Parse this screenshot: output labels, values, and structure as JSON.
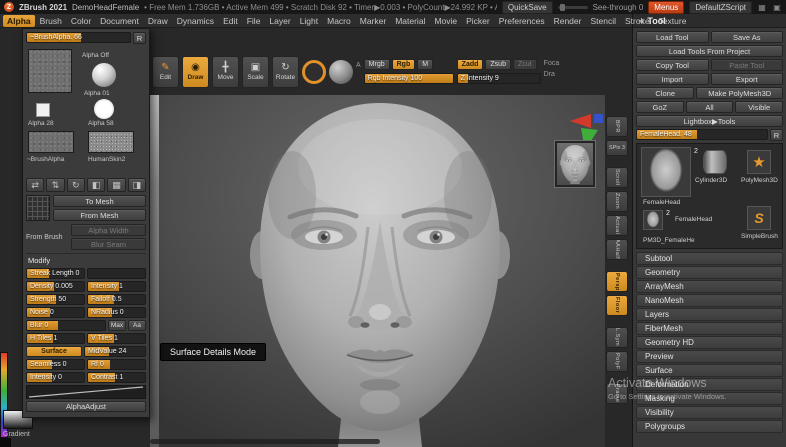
{
  "accent": "#d98c28",
  "icons": {
    "logo": "Z",
    "window1": "▦",
    "window2": "▣",
    "collapse": "◀",
    "edit": "✎",
    "draw": "◉",
    "move": "╋",
    "scale": "▣",
    "rotate_mode": "↻",
    "flip_h": "⇄",
    "flip_v": "⇅",
    "rotate": "↻",
    "invert": "◧",
    "grid": "▦",
    "contrast": "◨",
    "star": "★",
    "s_brush": "S"
  },
  "titlebar": {
    "app_title": "ZBrush 2021",
    "doc_name": "DemoHeadFemale",
    "stats": "• Free Mem 1.736GB • Active Mem 499 • Scratch Disk 92 • Timer▶0.003 • PolyCount▶24.992 KP • AC",
    "quicksave": "QuickSave",
    "see_through": "See-through 0",
    "menus": "Menus",
    "zscript": "DefaultZScript"
  },
  "menubar": {
    "items": [
      "Alpha",
      "Brush",
      "Color",
      "Document",
      "Draw",
      "Dynamics",
      "Edit",
      "File",
      "Layer",
      "Light",
      "Macro",
      "Marker",
      "Material",
      "Movie",
      "Picker",
      "Preferences",
      "Render",
      "Stencil",
      "Stroke",
      "Texture"
    ]
  },
  "alpha_panel": {
    "header": "~BrushAlpha. 66",
    "r": "R",
    "alpha_off": "Alpha Off",
    "alpha01": "Alpha 01",
    "alpha28": "Alpha 28",
    "alpha58": "Alpha 58",
    "brush_alpha": "~BrushAlpha",
    "humanskin": "HumanSkin2",
    "to_mesh": "To Mesh",
    "from_mesh": "From Mesh",
    "from_brush": "From Brush",
    "alpha_width": "Alpha Width",
    "blur_seam": "Blur Seam",
    "modify_title": "Modify",
    "streak": "Streak Length 0",
    "density": "Density 0.005",
    "intensity1": "Intensity 1",
    "strength": "Strength 50",
    "falloff": "Falloff 0.5",
    "noise": "Noise 0",
    "nradius": "NRadius 0",
    "blur": "Blur 0",
    "max": "Max",
    "aa": "Aa",
    "h_tiles": "H Tiles 1",
    "v_tiles": "V Tiles 1",
    "surface": "Surface",
    "midvalue": "MidValue 24",
    "seamless": "Seamless 0",
    "rf": "Rf 0",
    "intensity0": "Intensity 0",
    "contrast": "Contrast 1",
    "alphaadjust": "AlphaAdjust"
  },
  "shelf": {
    "edit": "Edit",
    "draw": "Draw",
    "move": "Move",
    "scale": "Scale",
    "rotate": "Rotate",
    "a": "A",
    "mrgb": "Mrgb",
    "rgb": "Rgb",
    "m": "M",
    "zadd": "Zadd",
    "zsub": "Zsub",
    "zcut": "Zcut",
    "rgb_intensity": "Rgb Intensity 100",
    "z_intensity": "Z Intensity 9",
    "focal": "Foca",
    "draw_size": "Dra"
  },
  "right_shelf": {
    "items": [
      "BPR",
      "SPix 3",
      "Scroll",
      "Zoom",
      "Actual",
      "AAHalf",
      "Persp",
      "Floor",
      "L.Sym",
      "PolyF",
      "Frame"
    ]
  },
  "canvas": {
    "tooltip": "Surface Details Mode"
  },
  "tool_panel": {
    "title": "Tool",
    "load_tool": "Load Tool",
    "save_as": "Save As",
    "load_from_project": "Load Tools From Project",
    "copy_tool": "Copy Tool",
    "paste_tool": "Paste Tool",
    "import": "Import",
    "export": "Export",
    "clone": "Clone",
    "make_polymesh": "Make PolyMesh3D",
    "goz": "GoZ",
    "all": "All",
    "visible": "Visible",
    "lightbox": "Lightbox▶Tools",
    "tool_slider": "FemaleHead. 48",
    "r": "R",
    "thumbs": {
      "main": "FemaleHead",
      "badge2": "2",
      "cylinder": "Cylinder3D",
      "polymesh": "PolyMesh3D",
      "female2": "FemaleHead",
      "simplebrush": "SimpleBrush",
      "pm3d": "PM3D_FemaleHe"
    },
    "sections": [
      "Subtool",
      "Geometry",
      "ArrayMesh",
      "NanoMesh",
      "Layers",
      "FiberMesh",
      "Geometry HD",
      "Preview",
      "Surface",
      "Deformation",
      "Masking",
      "Visibility",
      "Polygroups"
    ]
  },
  "watermark": {
    "line1": "Activate Windows",
    "line2": "Go to Settings to activate Windows."
  },
  "bottom": {
    "gradient_label": "Gradient"
  }
}
